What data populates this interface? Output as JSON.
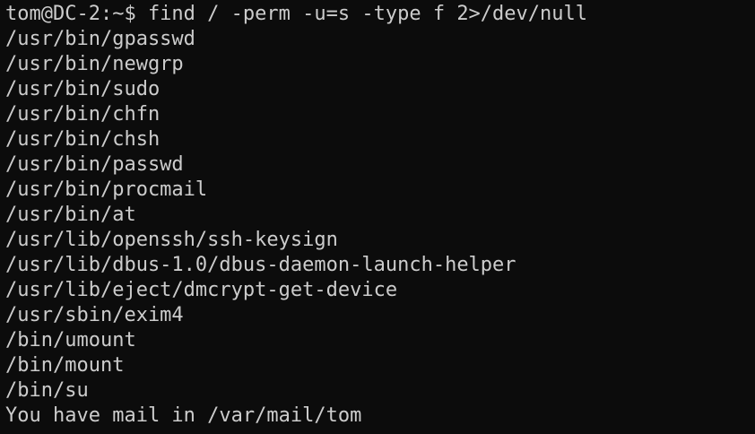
{
  "terminal": {
    "lines": [
      "tom@DC-2:~$ find / -perm -u=s -type f 2>/dev/null",
      "/usr/bin/gpasswd",
      "/usr/bin/newgrp",
      "/usr/bin/sudo",
      "/usr/bin/chfn",
      "/usr/bin/chsh",
      "/usr/bin/passwd",
      "/usr/bin/procmail",
      "/usr/bin/at",
      "/usr/lib/openssh/ssh-keysign",
      "/usr/lib/dbus-1.0/dbus-daemon-launch-helper",
      "/usr/lib/eject/dmcrypt-get-device",
      "/usr/sbin/exim4",
      "/bin/umount",
      "/bin/mount",
      "/bin/su",
      "You have mail in /var/mail/tom"
    ]
  },
  "colors": {
    "background": "#0c0c0c",
    "foreground": "#cccccc"
  }
}
